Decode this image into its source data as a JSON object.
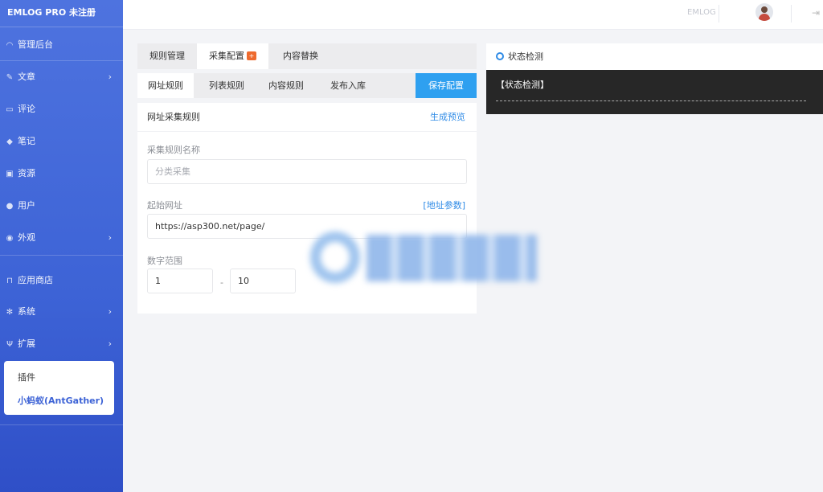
{
  "sidebar": {
    "brand": "EMLOG PRO 未注册",
    "items": [
      {
        "label": "管理后台",
        "icon": "dashboard-icon",
        "chevron": ""
      },
      {
        "label": "文章",
        "icon": "pencil-icon",
        "chevron": "›"
      },
      {
        "label": "评论",
        "icon": "comment-icon",
        "chevron": ""
      },
      {
        "label": "笔记",
        "icon": "note-icon",
        "chevron": ""
      },
      {
        "label": "资源",
        "icon": "image-icon",
        "chevron": ""
      },
      {
        "label": "用户",
        "icon": "user-icon",
        "chevron": ""
      },
      {
        "label": "外观",
        "icon": "palette-icon",
        "chevron": "›"
      },
      {
        "label": "应用商店",
        "icon": "cart-icon",
        "chevron": ""
      },
      {
        "label": "系统",
        "icon": "gear-icon",
        "chevron": "›"
      },
      {
        "label": "扩展",
        "icon": "plug-icon",
        "chevron": "›"
      }
    ],
    "submenu": {
      "item1": "插件",
      "item2": "小蚂蚁(AntGather)"
    }
  },
  "topbar": {
    "site_name": "EMLOG",
    "avatar_icon": "avatar-icon",
    "logout_icon": "logout-icon"
  },
  "tabs": {
    "main": [
      {
        "label": "规则管理"
      },
      {
        "label": "采集配置",
        "badge": "+"
      },
      {
        "label": "内容替换"
      }
    ],
    "sub": [
      {
        "label": "网址规则"
      },
      {
        "label": "列表规则"
      },
      {
        "label": "内容规则"
      },
      {
        "label": "发布入库"
      }
    ],
    "save_label": "保存配置"
  },
  "form": {
    "title": "网址采集规则",
    "preview_label": "生成预览",
    "rule_name_label": "采集规则名称",
    "rule_name_placeholder": "分类采集",
    "start_url_label": "起始网址",
    "url_param_label": "[地址参数]",
    "start_url_value": "https://asp300.net/page/",
    "number_range_label": "数字范围",
    "range_from": "1",
    "range_separator": "-",
    "range_to": "10"
  },
  "status_panel": {
    "title": "状态检测",
    "console_text": "【状态检测】"
  },
  "colors": {
    "sidebar": "#4e73df",
    "accent_blue": "#2ea0f0",
    "badge": "#ee6a2e",
    "console_bg": "#272727"
  }
}
